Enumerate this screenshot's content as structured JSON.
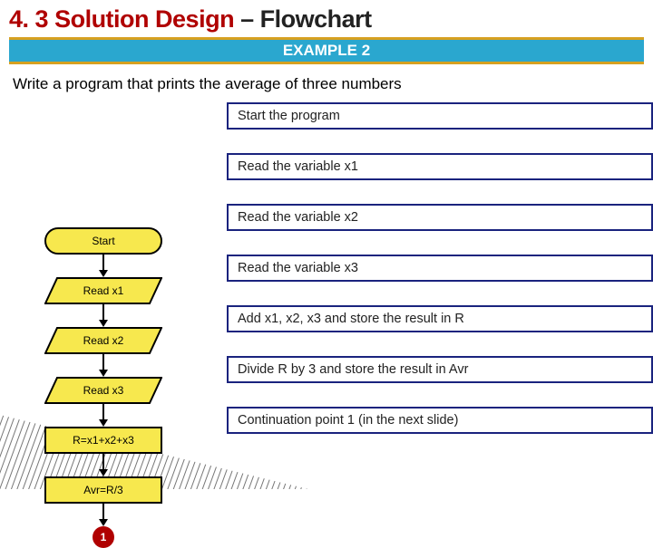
{
  "title": {
    "section_number": "4. 3",
    "main": "Solution Design",
    "separator": "–",
    "sub": "Flowchart"
  },
  "banner": "EXAMPLE 2",
  "prompt": "Write a program that prints the average of three numbers",
  "flow": [
    {
      "shape": "terminator",
      "label": "Start",
      "desc": "Start the program"
    },
    {
      "shape": "io",
      "label": "Read x1",
      "desc": "Read the variable x1"
    },
    {
      "shape": "io",
      "label": "Read x2",
      "desc": "Read the variable x2"
    },
    {
      "shape": "io",
      "label": "Read x3",
      "desc": "Read the variable x3"
    },
    {
      "shape": "process",
      "label": "R=x1+x2+x3",
      "desc": "Add x1, x2, x3 and store the result in R"
    },
    {
      "shape": "process",
      "label": "Avr=R/3",
      "desc": "Divide R by 3 and store the result in Avr"
    },
    {
      "shape": "connector",
      "label": "1",
      "desc": "Continuation point 1 (in the next slide)"
    }
  ],
  "colors": {
    "heading": "#b00000",
    "banner_bg": "#2aa7cf",
    "banner_border": "#d6a020",
    "shape_fill": "#f7e84e",
    "desc_border": "#1a237e",
    "connector": "#b00000"
  }
}
